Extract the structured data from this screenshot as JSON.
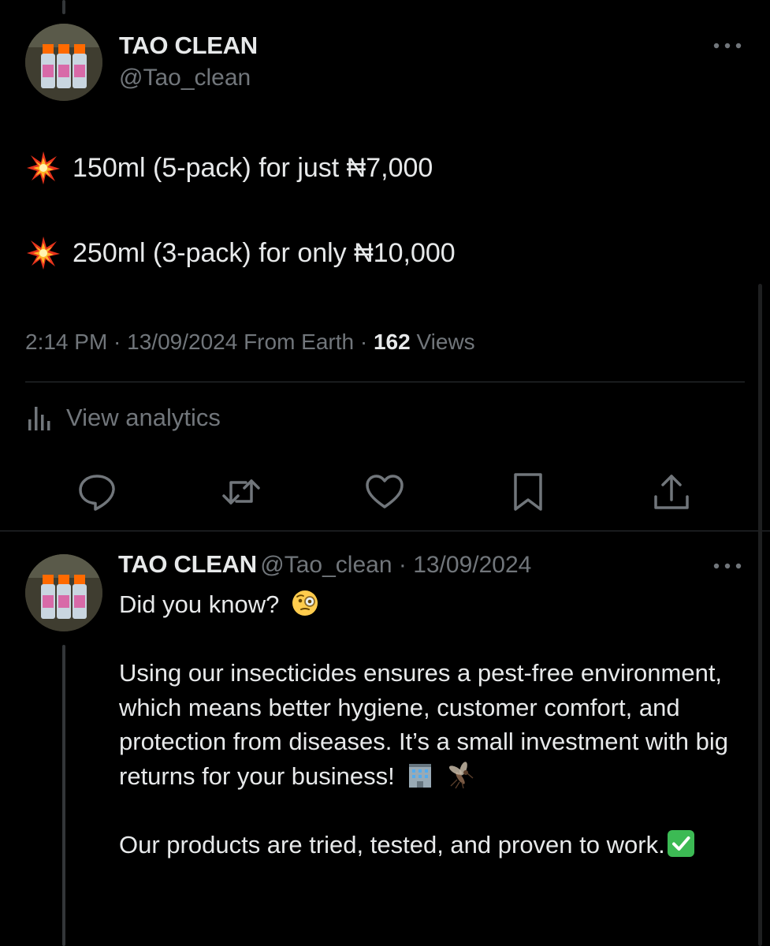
{
  "main_tweet": {
    "author_name": "TAO CLEAN",
    "author_handle": "@Tao_clean",
    "lines": [
      {
        "emoji": "collision-emoji",
        "text": "150ml (5-pack) for just ₦7,000"
      },
      {
        "emoji": "collision-emoji",
        "text": "250ml (3-pack) for only ₦10,000"
      }
    ],
    "meta_prefix": "2:14 PM · 13/09/2024 From Earth · ",
    "views_count": "162",
    "views_label": " Views",
    "analytics_label": "View analytics",
    "actions": [
      {
        "icon": "reply-icon"
      },
      {
        "icon": "retweet-icon"
      },
      {
        "icon": "like-icon"
      },
      {
        "icon": "bookmark-icon"
      },
      {
        "icon": "share-icon"
      }
    ]
  },
  "reply_tweet": {
    "author_name": "TAO CLEAN",
    "author_handle": "@Tao_clean",
    "separator": " · ",
    "date": "13/09/2024",
    "line1": "Did you know?",
    "para2": "Using our insecticides ensures a pest-free environment, which means better hygiene, customer comfort, and protection from diseases. It’s a small investment with big returns for your business!",
    "para3": "Our products are tried, tested, and proven to work."
  },
  "colors": {
    "background": "#000000",
    "primary_text": "#e7e9ea",
    "secondary_text": "#71767b",
    "divider": "#2f3336",
    "check_green": "#3cba54"
  }
}
